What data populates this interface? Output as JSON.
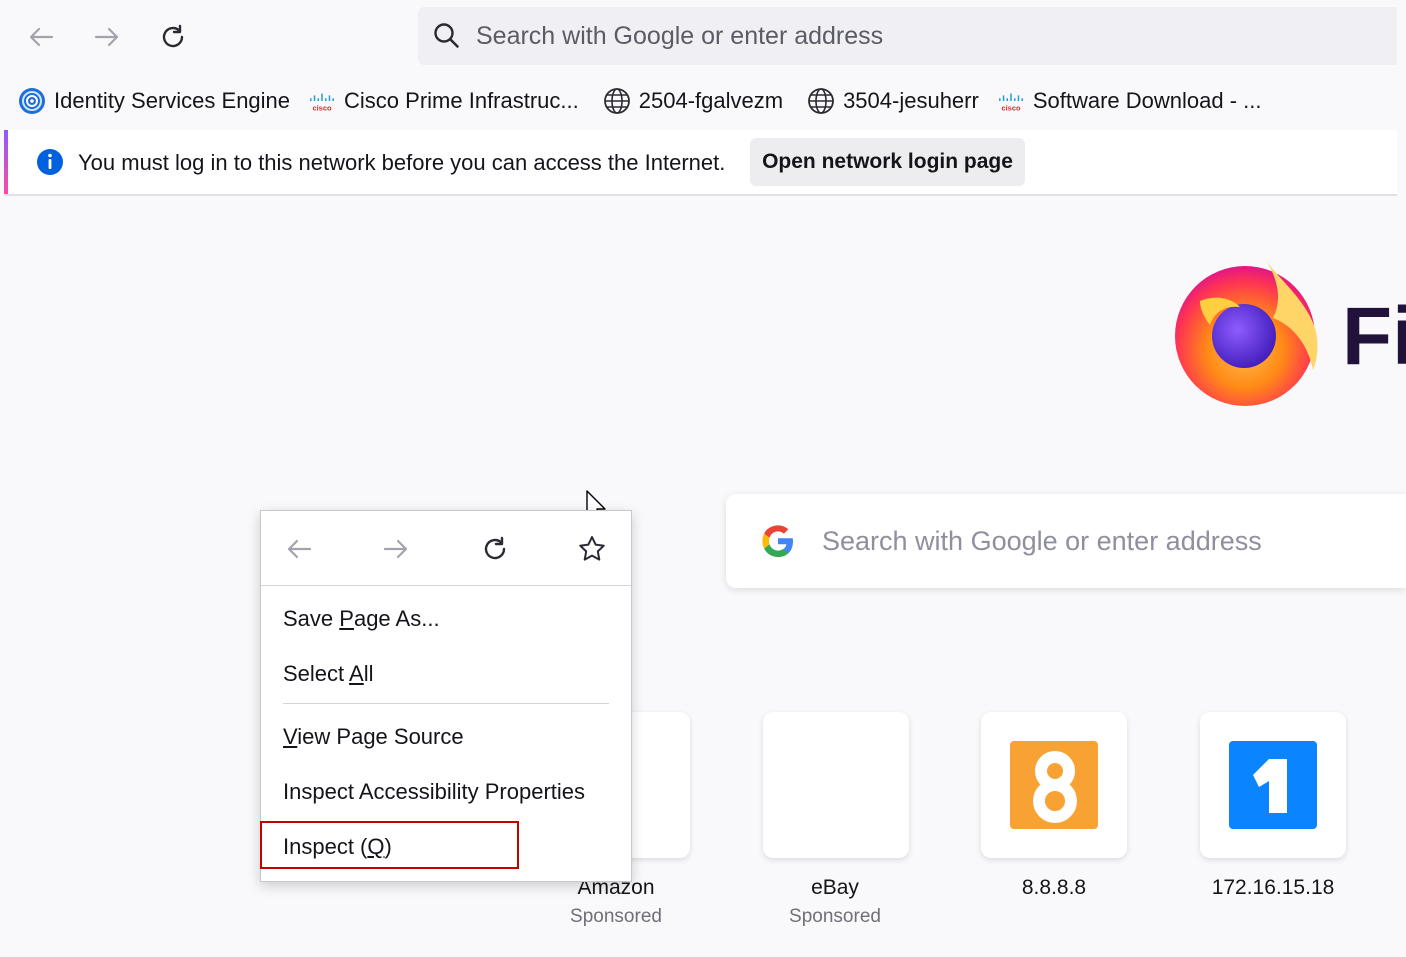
{
  "toolbar": {
    "back_icon": "arrow-left-icon",
    "forward_icon": "arrow-right-icon",
    "reload_icon": "reload-icon",
    "url_placeholder": "Search with Google or enter address"
  },
  "bookmarks": [
    {
      "label": "Identity Services Engine",
      "icon": "ise-icon"
    },
    {
      "label": "Cisco  Prime Infrastruc...",
      "icon": "cisco-icon"
    },
    {
      "label": "2504-fgalvezm",
      "icon": "globe-icon"
    },
    {
      "label": "3504-jesuherr",
      "icon": "globe-icon"
    },
    {
      "label": "Software Download - ...",
      "icon": "cisco-icon"
    }
  ],
  "notification": {
    "message": "You must log in to this network before you can access the Internet.",
    "button": "Open network login page",
    "accent": "#9059ff"
  },
  "brand": {
    "wordmark": "Fi"
  },
  "page_search": {
    "placeholder": "Search with Google or enter address"
  },
  "tiles": [
    {
      "label": "Amazon",
      "sub": "Sponsored"
    },
    {
      "label": "eBay",
      "sub": "Sponsored"
    },
    {
      "label": "8.8.8.8",
      "sub": "",
      "color": "#f7a233"
    },
    {
      "label": "172.16.15.18",
      "sub": "",
      "color": "#0a84ff"
    }
  ],
  "context_menu": {
    "items": [
      {
        "pre": "Save ",
        "key": "P",
        "post": "age As..."
      },
      {
        "pre": "Select ",
        "key": "A",
        "post": "ll"
      },
      {
        "pre": "",
        "key": "V",
        "post": "iew Page Source"
      },
      {
        "pre": "Inspect Accessibility Properties",
        "key": "",
        "post": ""
      },
      {
        "pre": "Inspect (",
        "key": "Q",
        "post": ")"
      }
    ],
    "highlight_color": "#c40000"
  }
}
